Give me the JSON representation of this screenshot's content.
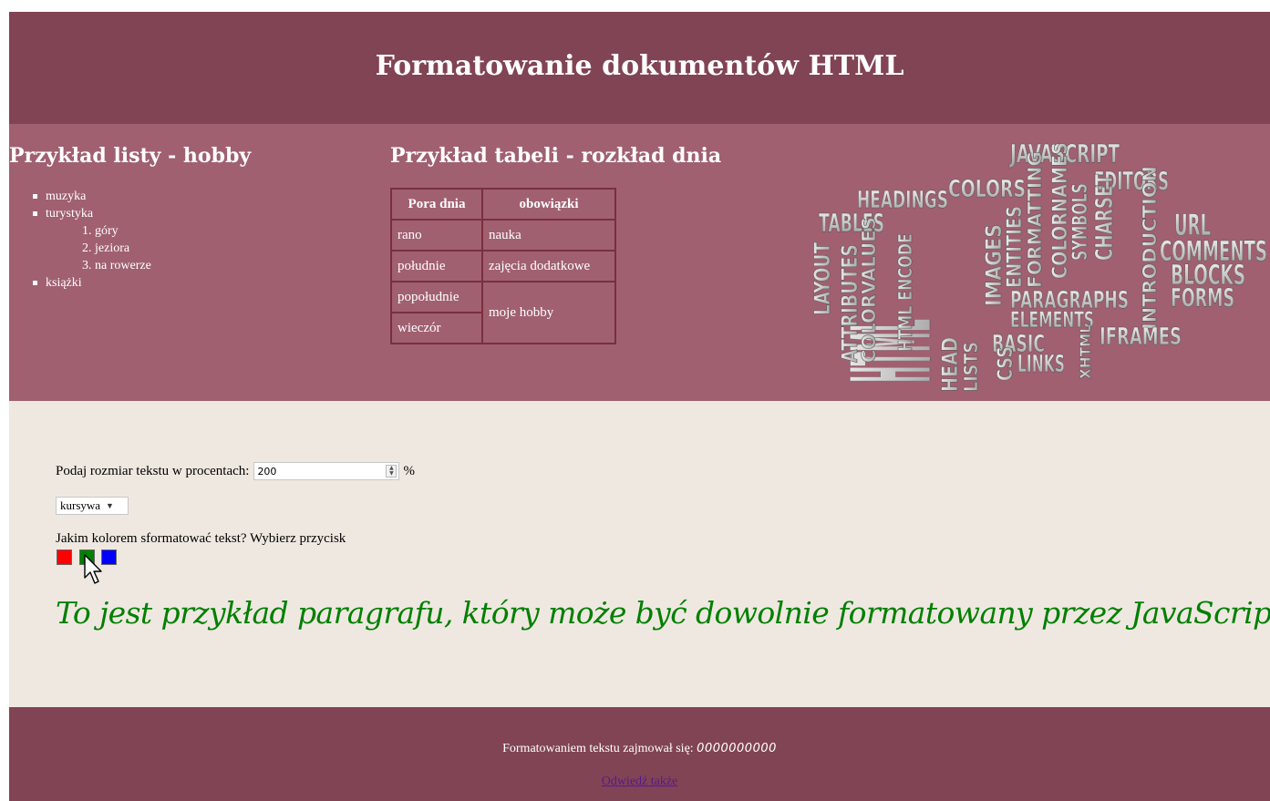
{
  "header": {
    "title": "Formatowanie dokumentów HTML"
  },
  "hobby": {
    "title": "Przykład listy - hobby",
    "items": [
      {
        "label": "muzyka"
      },
      {
        "label": "turystyka",
        "sub": [
          "1. góry",
          "2. jeziora",
          "3. na rowerze"
        ]
      },
      {
        "label": "książki"
      }
    ]
  },
  "schedule": {
    "title": "Przykład tabeli - rozkład dnia",
    "headers": [
      "Pora dnia",
      "obowiązki"
    ],
    "rows": [
      [
        "rano",
        "nauka"
      ],
      [
        "południe",
        "zajęcia dodatkowe"
      ],
      [
        "popołudnie",
        "moje hobby"
      ],
      [
        "wieczór",
        ""
      ]
    ]
  },
  "wordcloud": {
    "words": [
      "JAVASCRIPT",
      "COLORS",
      "EDITORS",
      "HEADINGS",
      "TABLES",
      "HTML",
      "URL",
      "COMMENTS",
      "BLOCKS",
      "FORMS",
      "LAYOUT",
      "ATTRIBUTES",
      "COLORVALUES",
      "HTML ENCODE",
      "IMAGES",
      "ENTITIES",
      "FORMATTING",
      "COLORNAMES",
      "SYMBOLS",
      "CHARSET",
      "INTRODUCTION",
      "PARAGRAPHS",
      "ELEMENTS",
      "BASIC",
      "LINKS",
      "IFRAMES",
      "HEAD",
      "LISTS",
      "CSS",
      "XHTML"
    ]
  },
  "controls": {
    "size_label": "Podaj rozmiar tekstu w procentach:",
    "size_value": "200",
    "percent_sign": "%",
    "style_select": "kursywa",
    "color_question": "Jakim kolorem sformatować tekst? Wybierz przycisk",
    "colors": {
      "red": "#ff0000",
      "green": "#008000",
      "blue": "#0000ff"
    }
  },
  "paragraph": {
    "text": "To jest przykład paragrafu, który może być dowolnie formatowany przez JavaScript",
    "color": "#008000"
  },
  "footer": {
    "prefix": "Formatowaniem tekstu zajmował się:",
    "name": "0000000000",
    "link": "Odwiedź także"
  },
  "theme": {
    "header_bg": "#814454",
    "section_bg": "#a06070",
    "content_bg": "#efe8e1"
  }
}
